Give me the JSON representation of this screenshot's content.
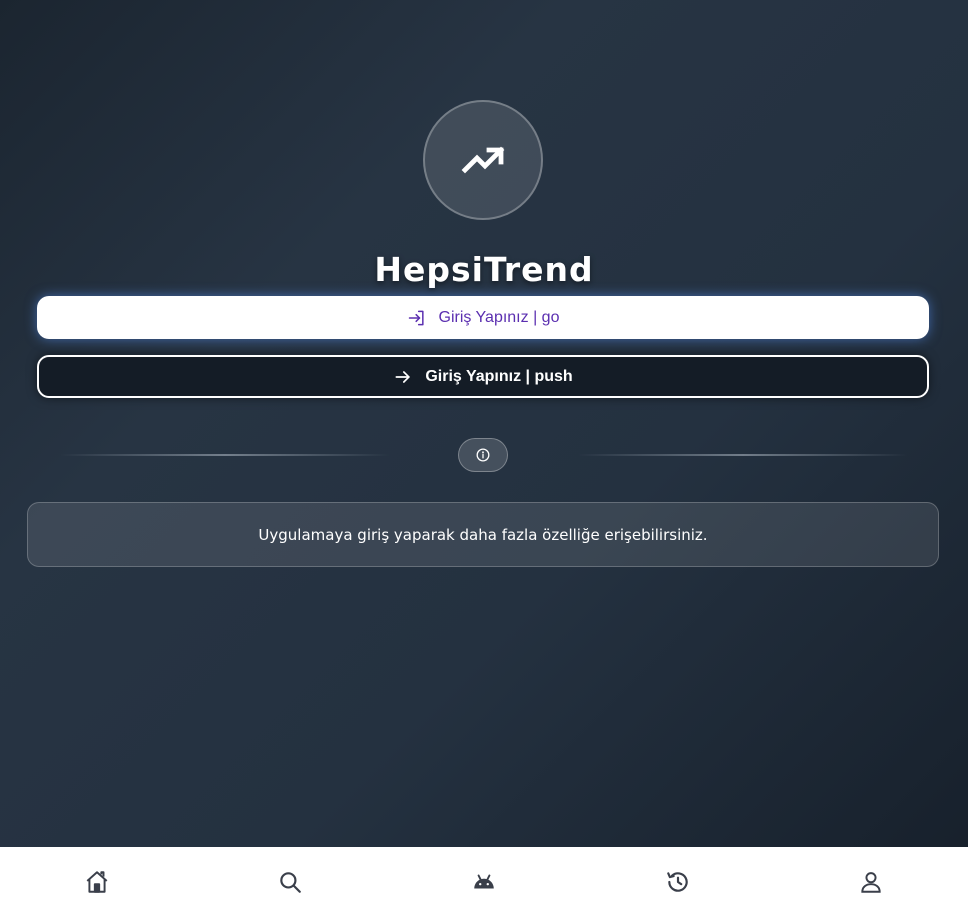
{
  "app": {
    "title": "HepsiTrend",
    "logo_icon": "trending-up-icon"
  },
  "buttons": {
    "go_label": "Giriş Yapınız | go",
    "go_icon": "login-icon",
    "push_label": "Giriş Yapınız | push",
    "push_icon": "arrow-right-icon"
  },
  "divider": {
    "icon": "info-icon"
  },
  "info_card": {
    "text": "Uygulamaya giriş yaparak daha fazla özelliğe erişebilirsiniz."
  },
  "bottom_nav": {
    "items": [
      {
        "icon": "home-icon"
      },
      {
        "icon": "search-icon"
      },
      {
        "icon": "android-icon"
      },
      {
        "icon": "history-icon"
      },
      {
        "icon": "profile-icon"
      }
    ]
  },
  "colors": {
    "accent": "#5b2fb0",
    "background_dark": "#1b2530",
    "nav_icon": "#3a3f4a"
  }
}
